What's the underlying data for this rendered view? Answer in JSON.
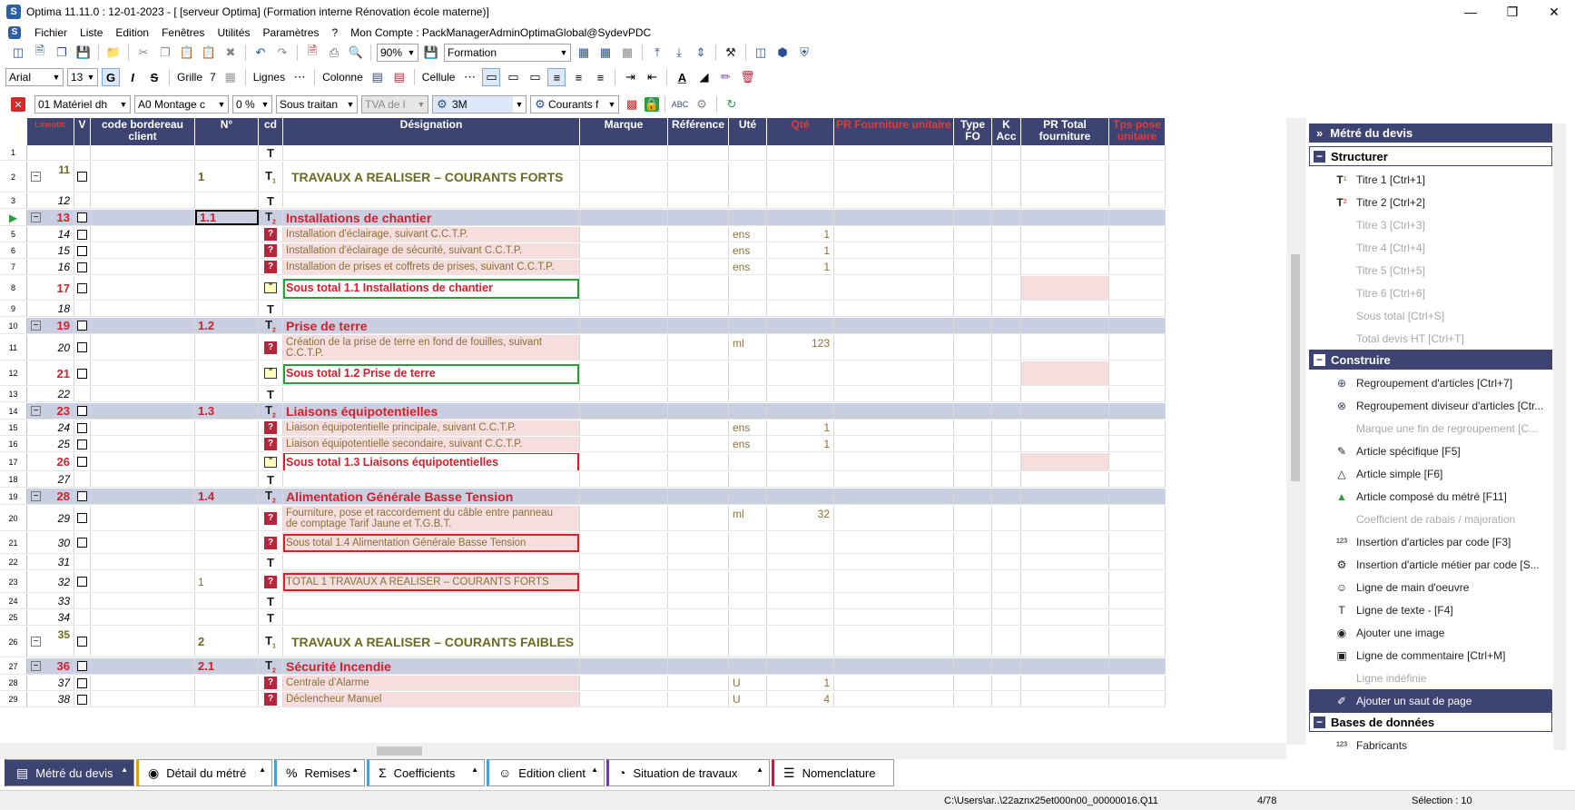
{
  "window": {
    "title": "Optima 11.11.0 : 12-01-2023 - [ [serveur Optima] (Formation interne Rénovation école materne)]"
  },
  "menu": [
    "Fichier",
    "Liste",
    "Edition",
    "Fenêtres",
    "Utilités",
    "Paramètres",
    "?",
    "Mon Compte : PackManagerAdminOptimaGlobal@SydevPDC"
  ],
  "toolbar1": {
    "zoom": "90%",
    "profile": "Formation"
  },
  "toolbar2": {
    "font": "Arial",
    "size": "13",
    "bold": "G",
    "italic": "I",
    "strike": "S",
    "grille": "Grille",
    "grille_val": "7",
    "lignes": "Lignes",
    "colonne": "Colonne",
    "cellule": "Cellule"
  },
  "toolbar3": {
    "lot": "01  Matériel dh",
    "section": "A0  Montage c",
    "pct": "0 %",
    "traitant": "Sous traitan",
    "tva": "TVA de l",
    "comp": "3M",
    "courant": "Courants f"
  },
  "grid": {
    "headers": [
      "",
      "",
      "V",
      "code bordereau client",
      "N°",
      "cd",
      "Désignation",
      "Marque",
      "Référence",
      "Uté",
      "Qté",
      "PR Fourniture unitaire",
      "Type FO",
      "K Acc",
      "PR Total fourniture",
      "Tps pose unitaire"
    ],
    "header_logo": "Lineotic",
    "rows": [
      {
        "ln": "1",
        "num": "",
        "n": "",
        "icon": "T",
        "desig": "",
        "ute": "",
        "qte": "",
        "type": "text"
      },
      {
        "ln": "2",
        "num": "11",
        "n": "1",
        "icon": "T1",
        "desig": "TRAVAUX A REALISER – COURANTS FORTS",
        "ute": "",
        "qte": "",
        "type": "t1"
      },
      {
        "ln": "3",
        "num": "12",
        "n": "",
        "icon": "T",
        "desig": "",
        "ute": "",
        "qte": "",
        "type": "text"
      },
      {
        "ln": "4",
        "num": "13",
        "n": "1.1",
        "icon": "T2",
        "desig": "Installations de chantier",
        "ute": "",
        "qte": "",
        "type": "t2"
      },
      {
        "ln": "5",
        "num": "14",
        "n": "",
        "icon": "?",
        "desig": "Installation d'éclairage, suivant C.C.T.P.",
        "ute": "ens",
        "qte": "1",
        "type": "art"
      },
      {
        "ln": "6",
        "num": "15",
        "n": "",
        "icon": "?",
        "desig": "Installation d'éclairage de sécurité, suivant C.C.T.P.",
        "ute": "ens",
        "qte": "1",
        "type": "art"
      },
      {
        "ln": "7",
        "num": "16",
        "n": "",
        "icon": "?",
        "desig": "Installation de prises et coffrets de prises, suivant C.C.T.P.",
        "ute": "ens",
        "qte": "1",
        "type": "art"
      },
      {
        "ln": "8",
        "num": "17",
        "n": "",
        "icon": "ST",
        "desig": "Sous total 1.1 Installations de chantier",
        "ute": "",
        "qte": "",
        "type": "st-green"
      },
      {
        "ln": "9",
        "num": "18",
        "n": "",
        "icon": "T",
        "desig": "",
        "ute": "",
        "qte": "",
        "type": "text"
      },
      {
        "ln": "10",
        "num": "19",
        "n": "1.2",
        "icon": "T2",
        "desig": "Prise de terre",
        "ute": "",
        "qte": "",
        "type": "t2"
      },
      {
        "ln": "11",
        "num": "20",
        "n": "",
        "icon": "?",
        "desig": "Création de la prise de terre en fond de fouilles, suivant",
        "desig2": "C.C.T.P.",
        "ute": "ml",
        "qte": "123",
        "type": "art2"
      },
      {
        "ln": "12",
        "num": "21",
        "n": "",
        "icon": "ST",
        "desig": "Sous total 1.2 Prise de terre",
        "ute": "",
        "qte": "",
        "type": "st-green"
      },
      {
        "ln": "13",
        "num": "22",
        "n": "",
        "icon": "T",
        "desig": "",
        "ute": "",
        "qte": "",
        "type": "text"
      },
      {
        "ln": "14",
        "num": "23",
        "n": "1.3",
        "icon": "T2",
        "desig": "Liaisons équipotentielles",
        "ute": "",
        "qte": "",
        "type": "t2"
      },
      {
        "ln": "15",
        "num": "24",
        "n": "",
        "icon": "?",
        "desig": "Liaison équipotentielle principale, suivant C.C.T.P.",
        "ute": "ens",
        "qte": "1",
        "type": "art"
      },
      {
        "ln": "16",
        "num": "25",
        "n": "",
        "icon": "?",
        "desig": "Liaison équipotentielle secondaire, suivant C.C.T.P.",
        "ute": "ens",
        "qte": "1",
        "type": "art"
      },
      {
        "ln": "17",
        "num": "26",
        "n": "",
        "icon": "ST",
        "desig": "Sous total 1.3 Liaisons équipotentielles",
        "ute": "",
        "qte": "",
        "type": "st-red"
      },
      {
        "ln": "18",
        "num": "27",
        "n": "",
        "icon": "T",
        "desig": "",
        "ute": "",
        "qte": "",
        "type": "text"
      },
      {
        "ln": "19",
        "num": "28",
        "n": "1.4",
        "icon": "T2",
        "desig": "Alimentation Générale Basse Tension",
        "ute": "",
        "qte": "",
        "type": "t2"
      },
      {
        "ln": "20",
        "num": "29",
        "n": "",
        "icon": "?",
        "desig": "Fourniture, pose et raccordement du câble entre panneau",
        "desig2": "de comptage Tarif Jaune et T.G.B.T.",
        "ute": "ml",
        "qte": "32",
        "type": "art2"
      },
      {
        "ln": "21",
        "num": "30",
        "n": "",
        "icon": "?",
        "desig": "Sous total 1.4 Alimentation Générale Basse Tension",
        "ute": "",
        "qte": "",
        "type": "art-redbox"
      },
      {
        "ln": "22",
        "num": "31",
        "n": "",
        "icon": "T",
        "desig": "",
        "ute": "",
        "qte": "",
        "type": "text"
      },
      {
        "ln": "23",
        "num": "32",
        "n": "1",
        "icon": "?",
        "desig": "TOTAL 1 TRAVAUX A REALISER – COURANTS FORTS",
        "ute": "",
        "qte": "",
        "type": "art-redbox"
      },
      {
        "ln": "24",
        "num": "33",
        "n": "",
        "icon": "T",
        "desig": "",
        "ute": "",
        "qte": "",
        "type": "text"
      },
      {
        "ln": "25",
        "num": "34",
        "n": "",
        "icon": "T",
        "desig": "",
        "ute": "",
        "qte": "",
        "type": "text"
      },
      {
        "ln": "26",
        "num": "35",
        "n": "2",
        "icon": "T1",
        "desig": "TRAVAUX A REALISER – COURANTS FAIBLES",
        "ute": "",
        "qte": "",
        "type": "t1"
      },
      {
        "ln": "27",
        "num": "36",
        "n": "2.1",
        "icon": "T2",
        "desig": "Sécurité Incendie",
        "ute": "",
        "qte": "",
        "type": "t2"
      },
      {
        "ln": "28",
        "num": "37",
        "n": "",
        "icon": "?",
        "desig": "Centrale d'Alarme",
        "ute": "U",
        "qte": "1",
        "type": "art"
      },
      {
        "ln": "29",
        "num": "38",
        "n": "",
        "icon": "?",
        "desig": "Déclencheur Manuel",
        "ute": "U",
        "qte": "4",
        "type": "art"
      }
    ]
  },
  "panel": {
    "title": "Métré du devis",
    "sections": [
      {
        "label": "Structurer",
        "items": [
          {
            "icon": "T1",
            "label": "Titre 1 [Ctrl+1]",
            "dis": false
          },
          {
            "icon": "T2",
            "label": "Titre 2 [Ctrl+2]",
            "dis": false
          },
          {
            "icon": "",
            "label": "Titre 3 [Ctrl+3]",
            "dis": true
          },
          {
            "icon": "",
            "label": "Titre 4 [Ctrl+4]",
            "dis": true
          },
          {
            "icon": "",
            "label": "Titre 5 [Ctrl+5]",
            "dis": true
          },
          {
            "icon": "",
            "label": "Titre 6 [Ctrl+6]",
            "dis": true
          },
          {
            "icon": "",
            "label": "Sous total [Ctrl+S]",
            "dis": true
          },
          {
            "icon": "",
            "label": "Total devis HT [Ctrl+T]",
            "dis": true
          }
        ]
      },
      {
        "label": "Construire",
        "items": [
          {
            "icon": "⊕",
            "label": "Regroupement d'articles  [Ctrl+7]",
            "dis": false
          },
          {
            "icon": "⊗",
            "label": "Regroupement diviseur d'articles [Ctr...",
            "dis": false
          },
          {
            "icon": "",
            "label": "Marque une fin de regroupement   [C...",
            "dis": true
          },
          {
            "icon": "✎",
            "label": "Article spécifique [F5]",
            "dis": false
          },
          {
            "icon": "△",
            "label": "Article simple [F6]",
            "dis": false
          },
          {
            "icon": "▲",
            "label": "Article composé du métré [F11]",
            "dis": false
          },
          {
            "icon": "",
            "label": "Coefficient de rabais / majoration",
            "dis": true
          },
          {
            "icon": "¹²³",
            "label": "Insertion d'articles par code [F3]",
            "dis": false
          },
          {
            "icon": "⚙",
            "label": "Insertion d'article métier par code [S...",
            "dis": false
          },
          {
            "icon": "☺",
            "label": "Ligne de main d'oeuvre",
            "dis": false
          },
          {
            "icon": "T",
            "label": "Ligne de texte - [F4]",
            "dis": false
          },
          {
            "icon": "◉",
            "label": "Ajouter une image",
            "dis": false
          },
          {
            "icon": "▣",
            "label": "Ligne de commentaire [Ctrl+M]",
            "dis": false
          },
          {
            "icon": "",
            "label": "Ligne indéfinie",
            "dis": true
          },
          {
            "icon": "✐",
            "label": "Ajouter un saut de page",
            "dis": false,
            "hl": true
          }
        ]
      },
      {
        "label": "Bases de données",
        "items": [
          {
            "icon": "¹²³",
            "label": "Fabricants",
            "dis": false
          }
        ]
      }
    ]
  },
  "tabs": [
    {
      "label": "Métré du devis",
      "icon": "▤",
      "active": true
    },
    {
      "label": "Détail du métré",
      "icon": "◉",
      "active": false
    },
    {
      "label": "Remises",
      "icon": "%",
      "active": false
    },
    {
      "label": "Coefficients",
      "icon": "Σ",
      "active": false
    },
    {
      "label": "Edition client",
      "icon": "☺",
      "active": false
    },
    {
      "label": "Situation de travaux",
      "icon": "◔",
      "active": false
    },
    {
      "label": "Nomenclature",
      "icon": "☰",
      "active": false
    }
  ],
  "status": {
    "path": "C:\\Users\\ar..\\22aznx25et000n00_00000016.Q11",
    "page": "4/78",
    "selection": "Sélection : 10"
  },
  "colors": {
    "header": "#3e4472",
    "title2": "#d2202c",
    "title1": "#6b6b1e",
    "pink": "#f6dede",
    "green": "#2a9d3c"
  }
}
